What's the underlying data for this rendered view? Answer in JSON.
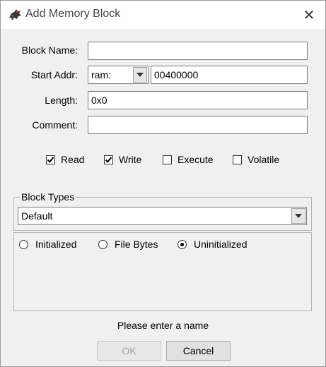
{
  "window": {
    "title": "Add Memory Block",
    "close_glyph": "✕",
    "icon": "dragon-app-icon"
  },
  "form": {
    "block_name": {
      "label": "Block Name:",
      "value": ""
    },
    "start_addr": {
      "label": "Start Addr:",
      "space_value": "ram:",
      "address_value": "00400000"
    },
    "length": {
      "label": "Length:",
      "value": "0x0"
    },
    "comment": {
      "label": "Comment:",
      "value": ""
    }
  },
  "permissions": [
    {
      "label": "Read",
      "checked": true
    },
    {
      "label": "Write",
      "checked": true
    },
    {
      "label": "Execute",
      "checked": false
    },
    {
      "label": "Volatile",
      "checked": false
    }
  ],
  "block_types": {
    "legend": "Block Types",
    "selected": "Default"
  },
  "initialization": [
    {
      "label": "Initialized",
      "selected": false
    },
    {
      "label": "File Bytes",
      "selected": false
    },
    {
      "label": "Uninitialized",
      "selected": true
    }
  ],
  "status": {
    "message": "Please enter a name"
  },
  "buttons": {
    "ok_label": "OK",
    "ok_enabled": false,
    "cancel_label": "Cancel"
  },
  "colors": {
    "window_bg": "#f0f0f0",
    "titlebar_bg": "#ffffff",
    "disabled_text": "#a0a0a0"
  }
}
